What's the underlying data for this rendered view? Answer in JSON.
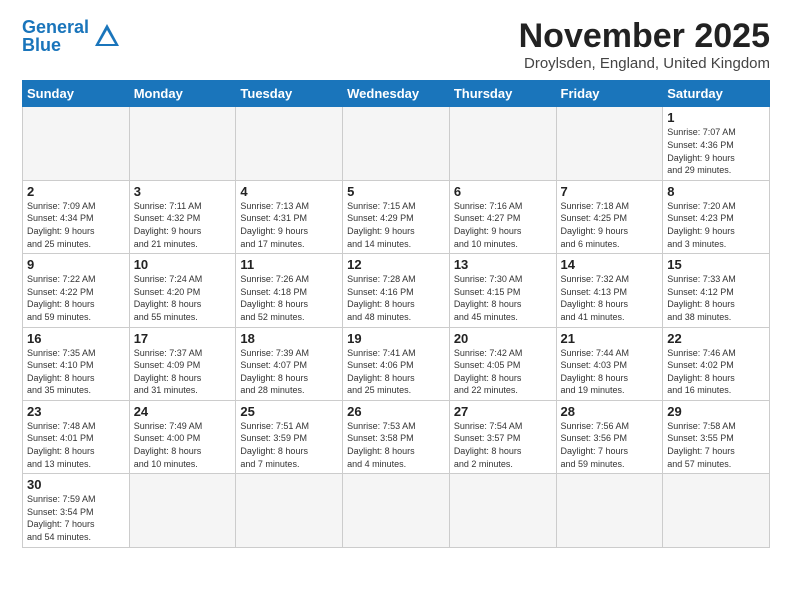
{
  "header": {
    "logo_general": "General",
    "logo_blue": "Blue",
    "title": "November 2025",
    "subtitle": "Droylsden, England, United Kingdom"
  },
  "weekdays": [
    "Sunday",
    "Monday",
    "Tuesday",
    "Wednesday",
    "Thursday",
    "Friday",
    "Saturday"
  ],
  "weeks": [
    [
      {
        "day": "",
        "empty": true
      },
      {
        "day": "",
        "empty": true
      },
      {
        "day": "",
        "empty": true
      },
      {
        "day": "",
        "empty": true
      },
      {
        "day": "",
        "empty": true
      },
      {
        "day": "",
        "empty": true
      },
      {
        "day": "1",
        "info": "Sunrise: 7:07 AM\nSunset: 4:36 PM\nDaylight: 9 hours\nand 29 minutes."
      }
    ],
    [
      {
        "day": "2",
        "info": "Sunrise: 7:09 AM\nSunset: 4:34 PM\nDaylight: 9 hours\nand 25 minutes."
      },
      {
        "day": "3",
        "info": "Sunrise: 7:11 AM\nSunset: 4:32 PM\nDaylight: 9 hours\nand 21 minutes."
      },
      {
        "day": "4",
        "info": "Sunrise: 7:13 AM\nSunset: 4:31 PM\nDaylight: 9 hours\nand 17 minutes."
      },
      {
        "day": "5",
        "info": "Sunrise: 7:15 AM\nSunset: 4:29 PM\nDaylight: 9 hours\nand 14 minutes."
      },
      {
        "day": "6",
        "info": "Sunrise: 7:16 AM\nSunset: 4:27 PM\nDaylight: 9 hours\nand 10 minutes."
      },
      {
        "day": "7",
        "info": "Sunrise: 7:18 AM\nSunset: 4:25 PM\nDaylight: 9 hours\nand 6 minutes."
      },
      {
        "day": "8",
        "info": "Sunrise: 7:20 AM\nSunset: 4:23 PM\nDaylight: 9 hours\nand 3 minutes."
      }
    ],
    [
      {
        "day": "9",
        "info": "Sunrise: 7:22 AM\nSunset: 4:22 PM\nDaylight: 8 hours\nand 59 minutes."
      },
      {
        "day": "10",
        "info": "Sunrise: 7:24 AM\nSunset: 4:20 PM\nDaylight: 8 hours\nand 55 minutes."
      },
      {
        "day": "11",
        "info": "Sunrise: 7:26 AM\nSunset: 4:18 PM\nDaylight: 8 hours\nand 52 minutes."
      },
      {
        "day": "12",
        "info": "Sunrise: 7:28 AM\nSunset: 4:16 PM\nDaylight: 8 hours\nand 48 minutes."
      },
      {
        "day": "13",
        "info": "Sunrise: 7:30 AM\nSunset: 4:15 PM\nDaylight: 8 hours\nand 45 minutes."
      },
      {
        "day": "14",
        "info": "Sunrise: 7:32 AM\nSunset: 4:13 PM\nDaylight: 8 hours\nand 41 minutes."
      },
      {
        "day": "15",
        "info": "Sunrise: 7:33 AM\nSunset: 4:12 PM\nDaylight: 8 hours\nand 38 minutes."
      }
    ],
    [
      {
        "day": "16",
        "info": "Sunrise: 7:35 AM\nSunset: 4:10 PM\nDaylight: 8 hours\nand 35 minutes."
      },
      {
        "day": "17",
        "info": "Sunrise: 7:37 AM\nSunset: 4:09 PM\nDaylight: 8 hours\nand 31 minutes."
      },
      {
        "day": "18",
        "info": "Sunrise: 7:39 AM\nSunset: 4:07 PM\nDaylight: 8 hours\nand 28 minutes."
      },
      {
        "day": "19",
        "info": "Sunrise: 7:41 AM\nSunset: 4:06 PM\nDaylight: 8 hours\nand 25 minutes."
      },
      {
        "day": "20",
        "info": "Sunrise: 7:42 AM\nSunset: 4:05 PM\nDaylight: 8 hours\nand 22 minutes."
      },
      {
        "day": "21",
        "info": "Sunrise: 7:44 AM\nSunset: 4:03 PM\nDaylight: 8 hours\nand 19 minutes."
      },
      {
        "day": "22",
        "info": "Sunrise: 7:46 AM\nSunset: 4:02 PM\nDaylight: 8 hours\nand 16 minutes."
      }
    ],
    [
      {
        "day": "23",
        "info": "Sunrise: 7:48 AM\nSunset: 4:01 PM\nDaylight: 8 hours\nand 13 minutes."
      },
      {
        "day": "24",
        "info": "Sunrise: 7:49 AM\nSunset: 4:00 PM\nDaylight: 8 hours\nand 10 minutes."
      },
      {
        "day": "25",
        "info": "Sunrise: 7:51 AM\nSunset: 3:59 PM\nDaylight: 8 hours\nand 7 minutes."
      },
      {
        "day": "26",
        "info": "Sunrise: 7:53 AM\nSunset: 3:58 PM\nDaylight: 8 hours\nand 4 minutes."
      },
      {
        "day": "27",
        "info": "Sunrise: 7:54 AM\nSunset: 3:57 PM\nDaylight: 8 hours\nand 2 minutes."
      },
      {
        "day": "28",
        "info": "Sunrise: 7:56 AM\nSunset: 3:56 PM\nDaylight: 7 hours\nand 59 minutes."
      },
      {
        "day": "29",
        "info": "Sunrise: 7:58 AM\nSunset: 3:55 PM\nDaylight: 7 hours\nand 57 minutes."
      }
    ],
    [
      {
        "day": "30",
        "info": "Sunrise: 7:59 AM\nSunset: 3:54 PM\nDaylight: 7 hours\nand 54 minutes."
      },
      {
        "day": "",
        "empty": true
      },
      {
        "day": "",
        "empty": true
      },
      {
        "day": "",
        "empty": true
      },
      {
        "day": "",
        "empty": true
      },
      {
        "day": "",
        "empty": true
      },
      {
        "day": "",
        "empty": true
      }
    ]
  ]
}
